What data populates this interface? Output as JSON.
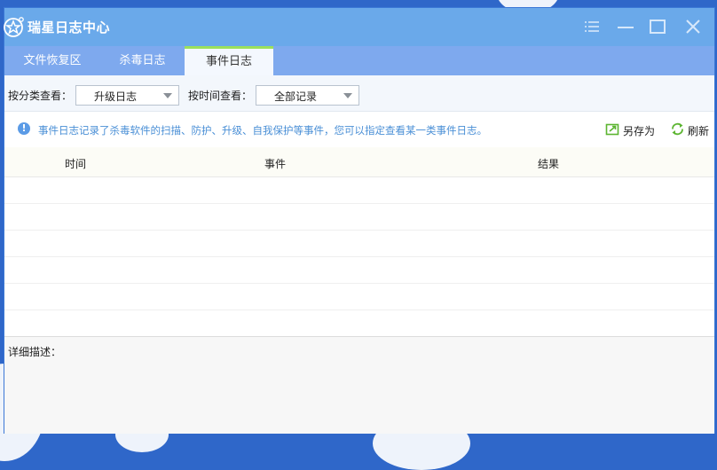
{
  "window": {
    "title": "瑞星日志中心"
  },
  "titlebar": {
    "menu_icon": "menu-icon",
    "minimize_icon": "minimize-icon",
    "maximize_icon": "maximize-icon",
    "close_icon": "close-icon"
  },
  "tabs": [
    {
      "label": "文件恢复区",
      "active": false
    },
    {
      "label": "杀毒日志",
      "active": false
    },
    {
      "label": "事件日志",
      "active": true
    }
  ],
  "filters": {
    "category_label": "按分类查看：",
    "category_value": "升级日志",
    "time_label": "按时间查看：",
    "time_value": "全部记录"
  },
  "info": {
    "text": "事件日志记录了杀毒软件的扫描、防护、升级、自我保护等事件，您可以指定查看某一类事件日志。",
    "save_as": "另存为",
    "refresh": "刷新"
  },
  "table": {
    "columns": [
      "时间",
      "事件",
      "结果"
    ],
    "rows": []
  },
  "detail": {
    "label": "详细描述："
  },
  "colors": {
    "titlebar": "#6aa9ea",
    "tabbar": "#7ea9ee",
    "active_tab_accent": "#9be05c",
    "info_text": "#4a8fd6",
    "action_icon": "#5cb531"
  }
}
